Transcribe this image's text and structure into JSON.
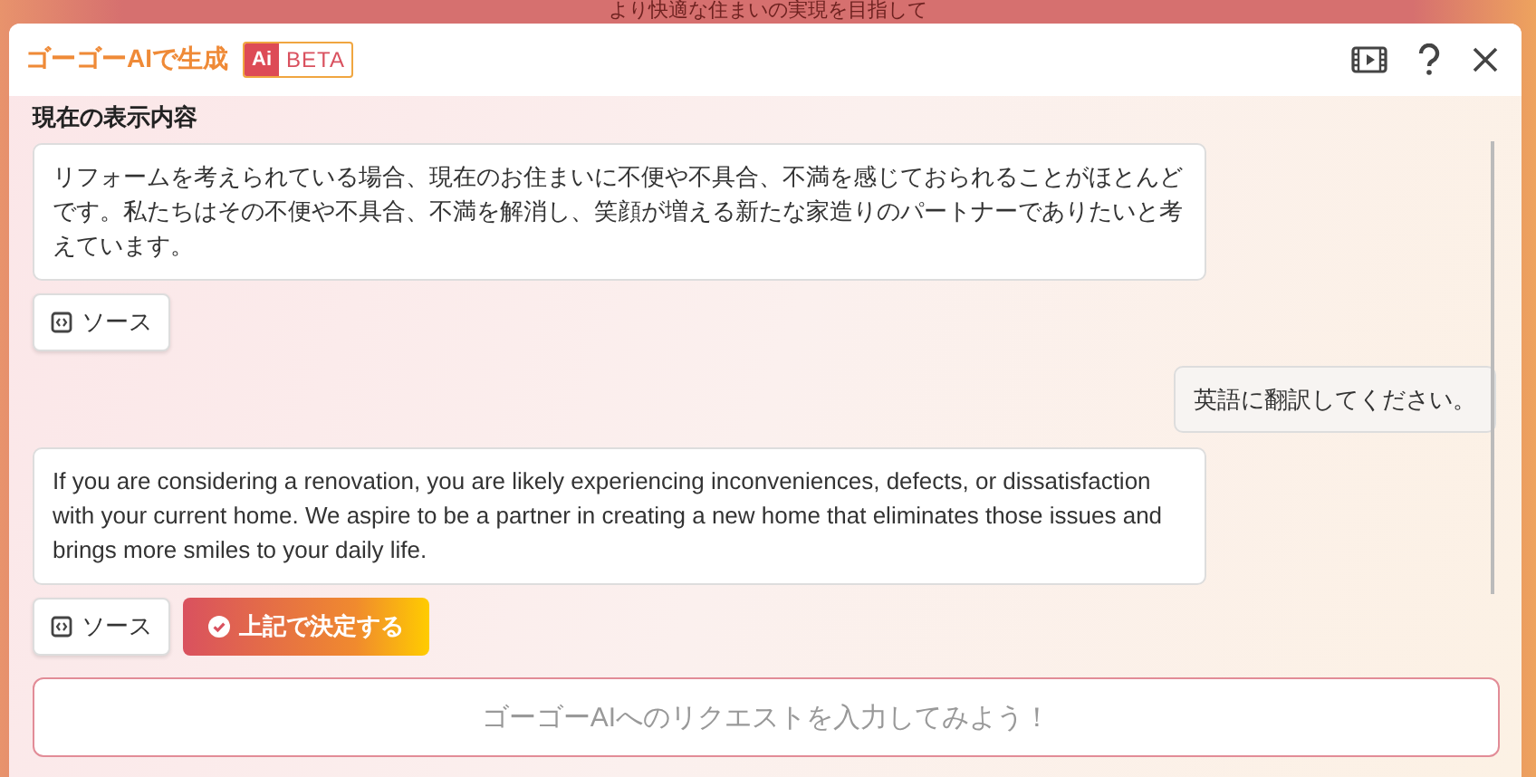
{
  "background": {
    "heading": "より快適な住まいの実現を目指して"
  },
  "header": {
    "title": "ゴーゴーAIで生成",
    "badge_logo": "Ai",
    "badge": "BETA"
  },
  "messages": [
    {
      "kind": "context",
      "heading": "現在の表示内容",
      "text": "リフォームを考えられている場合、現在のお住まいに不便や不具合、不満を感じておられることがほとんどです。私たちはその不便や不具合、不満を解消し、笑顔が増える新たな家造りのパートナーでありたいと考えています。",
      "buttons": [
        {
          "kind": "source",
          "label": "ソース"
        }
      ]
    },
    {
      "kind": "user",
      "text": "英語に翻訳してください。"
    },
    {
      "kind": "assistant",
      "text": "If you are considering a renovation, you are likely experiencing inconveniences, defects, or dissatisfaction with your current home. We aspire to be a partner in creating a new home that eliminates those issues and brings more smiles to your daily life.",
      "buttons": [
        {
          "kind": "source",
          "label": "ソース"
        },
        {
          "kind": "decide",
          "label": "上記で決定する"
        }
      ]
    }
  ],
  "input": {
    "placeholder": "ゴーゴーAIへのリクエストを入力してみよう！"
  }
}
